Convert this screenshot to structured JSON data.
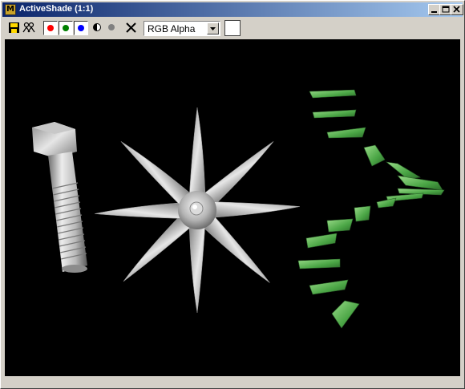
{
  "window": {
    "title": "ActiveShade (1:1)",
    "app_icon": "max-logo-icon"
  },
  "title_buttons": [
    {
      "name": "minimize-button",
      "icon": "minimize-icon"
    },
    {
      "name": "maximize-button",
      "icon": "maximize-icon"
    },
    {
      "name": "close-button",
      "icon": "close-icon"
    }
  ],
  "toolbar": {
    "save_icon": "save-icon",
    "clone_icon": "clone-icon",
    "channels": [
      {
        "name": "red-channel",
        "color": "#ff0000",
        "enabled": true
      },
      {
        "name": "green-channel",
        "color": "#008000",
        "enabled": true
      },
      {
        "name": "blue-channel",
        "color": "#0000ff",
        "enabled": true
      }
    ],
    "mono_icon": "monochrome-icon",
    "alpha_icon": "alpha-dot-icon",
    "clear_icon": "clear-x-icon",
    "channel_select": {
      "value": "RGB Alpha"
    },
    "background_swatch_color": "#ffffff"
  },
  "viewport": {
    "background": "#000000",
    "objects": [
      "bolt",
      "star-fan",
      "green-spiral-blades"
    ],
    "colors": {
      "metal": "#d0d0d0",
      "blades": "#4fb04f"
    }
  }
}
